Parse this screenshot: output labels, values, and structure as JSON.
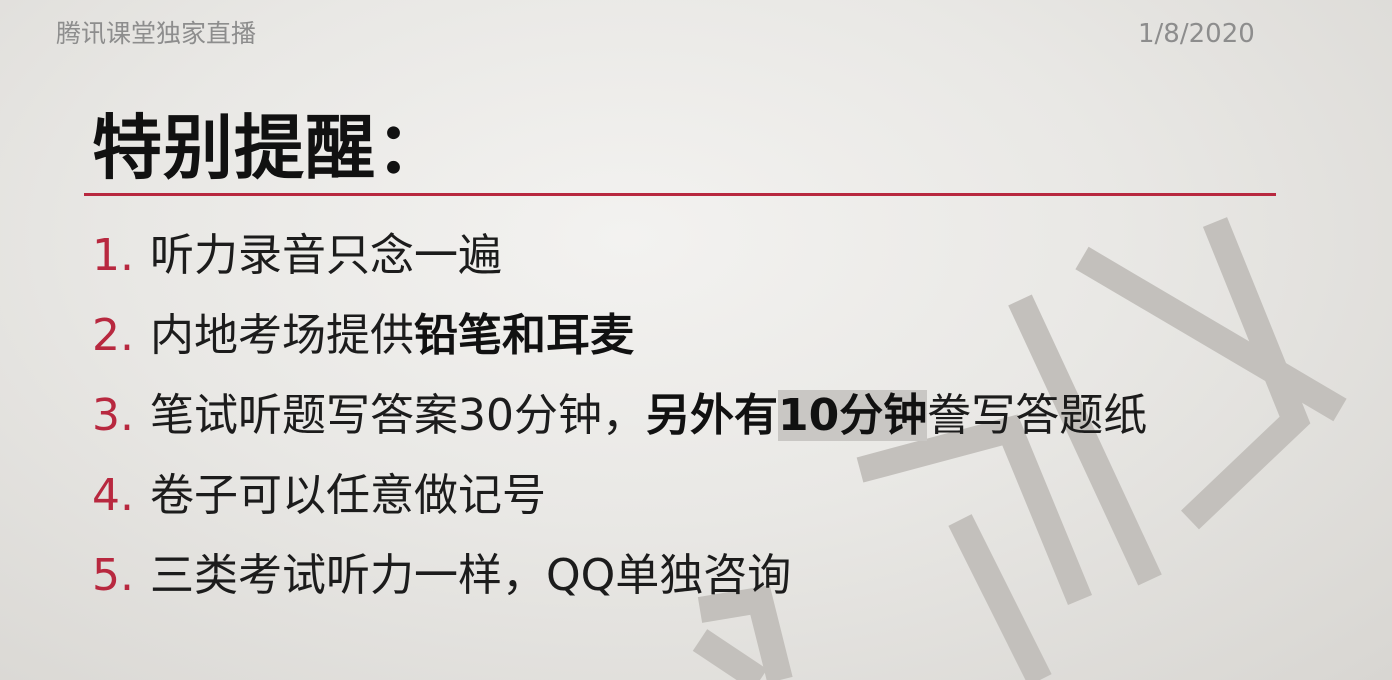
{
  "header": {
    "left_text": "腾讯课堂独家直播",
    "date": "1/8/2020"
  },
  "title": "特别提醒：",
  "items": [
    {
      "number": "1.",
      "text": "听力录音只念一遍"
    },
    {
      "number": "2.",
      "text_before": "内地考场提供",
      "text_bold": "铅笔和耳麦"
    },
    {
      "number": "3.",
      "text_before": "笔试听题写答案30分钟，",
      "text_bold": "另外有",
      "text_highlight": "10分钟",
      "text_after": "誊写答题纸"
    },
    {
      "number": "4.",
      "text": "卷子可以任意做记号"
    },
    {
      "number": "5.",
      "text": "三类考试听力一样，QQ单独咨询"
    }
  ],
  "watermark_text": "听力",
  "colors": {
    "accent": "#b8283f",
    "watermark": "#c3c0bc"
  }
}
